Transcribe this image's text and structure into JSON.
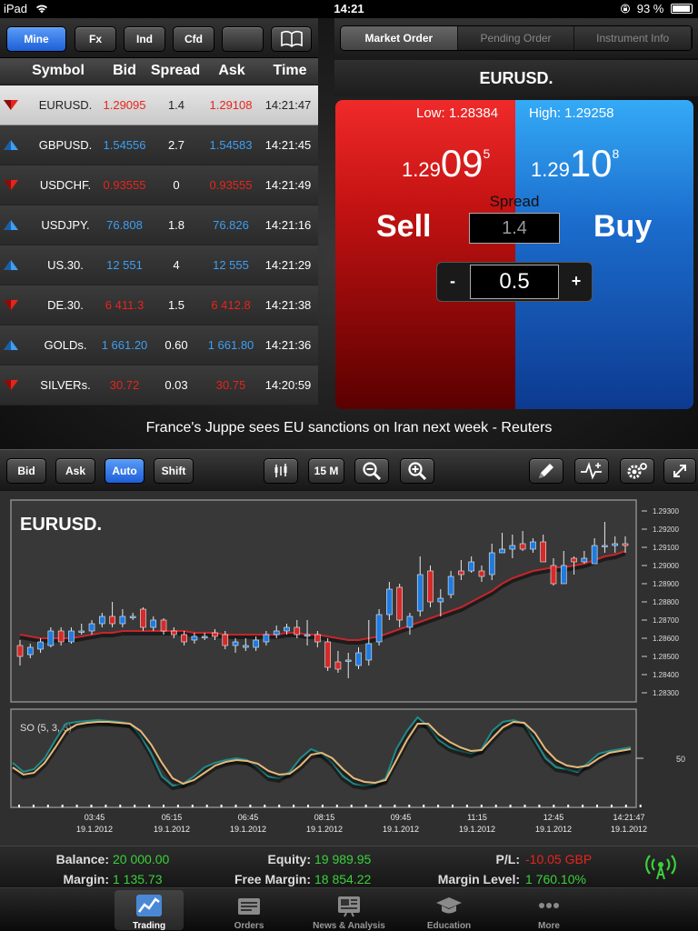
{
  "status": {
    "device": "iPad",
    "time": "14:21",
    "battery": "93 %"
  },
  "left_toolbar": {
    "buttons": [
      "Mine",
      "Fx",
      "Ind",
      "Cfd"
    ],
    "selected": "Mine",
    "book_icon": "book-icon"
  },
  "watchlist": {
    "headers": {
      "symbol": "Symbol",
      "bid": "Bid",
      "spread": "Spread",
      "ask": "Ask",
      "time": "Time"
    },
    "rows": [
      {
        "symbol": "EURUSD.",
        "bid": "1.29095",
        "spread": "1.4",
        "ask": "1.29108",
        "time": "14:21:47",
        "dir": "down",
        "selected": true
      },
      {
        "symbol": "GBPUSD.",
        "bid": "1.54556",
        "spread": "2.7",
        "ask": "1.54583",
        "time": "14:21:45",
        "dir": "up"
      },
      {
        "symbol": "USDCHF.",
        "bid": "0.93555",
        "spread": "0",
        "ask": "0.93555",
        "time": "14:21:49",
        "dir": "down"
      },
      {
        "symbol": "USDJPY.",
        "bid": "76.808",
        "spread": "1.8",
        "ask": "76.826",
        "time": "14:21:16",
        "dir": "up"
      },
      {
        "symbol": "US.30.",
        "bid": "12 551",
        "spread": "4",
        "ask": "12 555",
        "time": "14:21:29",
        "dir": "up"
      },
      {
        "symbol": "DE.30.",
        "bid": "6 411.3",
        "spread": "1.5",
        "ask": "6 412.8",
        "time": "14:21:38",
        "dir": "down"
      },
      {
        "symbol": "GOLDs.",
        "bid": "1 661.20",
        "spread": "0.60",
        "ask": "1 661.80",
        "time": "14:21:36",
        "dir": "up"
      },
      {
        "symbol": "SILVERs.",
        "bid": "30.72",
        "spread": "0.03",
        "ask": "30.75",
        "time": "14:20:59",
        "dir": "down"
      }
    ]
  },
  "order": {
    "tabs": [
      "Market Order",
      "Pending Order",
      "Instrument Info"
    ],
    "selected_tab": "Market Order",
    "instrument": "EURUSD.",
    "low": "Low: 1.28384",
    "high": "High: 1.29258",
    "sell": {
      "base": "1.29",
      "big": "09",
      "small": "5",
      "label": "Sell"
    },
    "buy": {
      "base": "1.29",
      "big": "10",
      "small": "8",
      "label": "Buy"
    },
    "spread_label": "Spread",
    "spread_value": "1.4",
    "volume": "0.5",
    "minus": "-",
    "plus": "+"
  },
  "news": {
    "headline": "France's Juppe sees EU sanctions on Iran next week - Reuters"
  },
  "chart_toolbar": {
    "buttons": [
      "Bid",
      "Ask",
      "Auto",
      "Shift"
    ],
    "selected": "Auto",
    "timeframe": "15 M",
    "icons": [
      "chart-type-icon",
      "zoom-out-icon",
      "zoom-in-icon",
      "pencil-icon",
      "indicator-icon",
      "settings-icon",
      "fullscreen-icon"
    ]
  },
  "chart_data": [
    {
      "type": "candlestick",
      "title": "EURUSD.",
      "y_ticks": [
        "1.29300",
        "1.29200",
        "1.29100",
        "1.29000",
        "1.28900",
        "1.28800",
        "1.28700",
        "1.28600",
        "1.28500",
        "1.28400",
        "1.28300"
      ],
      "ylim": [
        1.2826,
        1.2935
      ],
      "x_ticks": [
        {
          "time": "03:45",
          "date": "19.1.2012"
        },
        {
          "time": "05:15",
          "date": "19.1.2012"
        },
        {
          "time": "06:45",
          "date": "19.1.2012"
        },
        {
          "time": "08:15",
          "date": "19.1.2012"
        },
        {
          "time": "09:45",
          "date": "19.1.2012"
        },
        {
          "time": "11:15",
          "date": "19.1.2012"
        },
        {
          "time": "12:45",
          "date": "19.1.2012"
        },
        {
          "time": "14:21:47",
          "date": "19.1.2012"
        }
      ],
      "candles": [
        [
          1.2856,
          1.285,
          1.2859,
          1.2845
        ],
        [
          1.2851,
          1.2855,
          1.2857,
          1.2849
        ],
        [
          1.2854,
          1.2858,
          1.286,
          1.2852
        ],
        [
          1.2856,
          1.2864,
          1.2866,
          1.2855
        ],
        [
          1.2864,
          1.2858,
          1.2866,
          1.2856
        ],
        [
          1.2858,
          1.2864,
          1.2866,
          1.2857
        ],
        [
          1.2864,
          1.2864,
          1.2868,
          1.2862
        ],
        [
          1.2864,
          1.2868,
          1.287,
          1.2862
        ],
        [
          1.2868,
          1.2872,
          1.2874,
          1.2866
        ],
        [
          1.2872,
          1.2868,
          1.288,
          1.2866
        ],
        [
          1.2868,
          1.2872,
          1.2876,
          1.2866
        ],
        [
          1.2872,
          1.2872,
          1.2874,
          1.287
        ],
        [
          1.2876,
          1.2866,
          1.2877,
          1.2864
        ],
        [
          1.2866,
          1.287,
          1.2872,
          1.2864
        ],
        [
          1.287,
          1.2864,
          1.2871,
          1.2862
        ],
        [
          1.2864,
          1.2862,
          1.2866,
          1.286
        ],
        [
          1.2862,
          1.2858,
          1.2864,
          1.2856
        ],
        [
          1.2859,
          1.2861,
          1.2863,
          1.2857
        ],
        [
          1.2861,
          1.2861,
          1.2863,
          1.2859
        ],
        [
          1.2863,
          1.2861,
          1.2865,
          1.2859
        ],
        [
          1.2862,
          1.2856,
          1.2864,
          1.2854
        ],
        [
          1.2856,
          1.2858,
          1.286,
          1.2852
        ],
        [
          1.2855,
          1.2856,
          1.286,
          1.2853
        ],
        [
          1.2855,
          1.2859,
          1.2861,
          1.2853
        ],
        [
          1.2858,
          1.2862,
          1.2864,
          1.2856
        ],
        [
          1.2862,
          1.2864,
          1.2867,
          1.286
        ],
        [
          1.2864,
          1.2866,
          1.2868,
          1.2862
        ],
        [
          1.2866,
          1.2862,
          1.287,
          1.286
        ],
        [
          1.2862,
          1.2862,
          1.287,
          1.2856
        ],
        [
          1.2862,
          1.2858,
          1.2864,
          1.2855
        ],
        [
          1.2858,
          1.2844,
          1.286,
          1.2842
        ],
        [
          1.2847,
          1.2843,
          1.2853,
          1.2841
        ],
        [
          1.2848,
          1.2848,
          1.2852,
          1.2838
        ],
        [
          1.2845,
          1.2852,
          1.2855,
          1.2843
        ],
        [
          1.2848,
          1.2857,
          1.287,
          1.2845
        ],
        [
          1.2858,
          1.2873,
          1.2876,
          1.2856
        ],
        [
          1.2873,
          1.2887,
          1.2891,
          1.287
        ],
        [
          1.2888,
          1.287,
          1.289,
          1.2866
        ],
        [
          1.2866,
          1.2872,
          1.2874,
          1.2862
        ],
        [
          1.2875,
          1.2895,
          1.2905,
          1.2872
        ],
        [
          1.2897,
          1.288,
          1.29,
          1.2877
        ],
        [
          1.288,
          1.2882,
          1.2887,
          1.2872
        ],
        [
          1.2884,
          1.2894,
          1.2897,
          1.2882
        ],
        [
          1.2897,
          1.2895,
          1.2903,
          1.2892
        ],
        [
          1.2897,
          1.2902,
          1.2905,
          1.2896
        ],
        [
          1.2897,
          1.2894,
          1.29,
          1.2891
        ],
        [
          1.2895,
          1.2907,
          1.2912,
          1.2892
        ],
        [
          1.2907,
          1.2909,
          1.2918,
          1.2907
        ],
        [
          1.2909,
          1.2911,
          1.2917,
          1.2904
        ],
        [
          1.2912,
          1.2909,
          1.2919,
          1.2908
        ],
        [
          1.2909,
          1.2913,
          1.2915,
          1.2907
        ],
        [
          1.2913,
          1.2902,
          1.2917,
          1.2902
        ],
        [
          1.29,
          1.289,
          1.2904,
          1.2889
        ],
        [
          1.289,
          1.29,
          1.2908,
          1.289
        ],
        [
          1.2904,
          1.2902,
          1.2905,
          1.2895
        ],
        [
          1.2902,
          1.2904,
          1.2908,
          1.2901
        ],
        [
          1.2901,
          1.2911,
          1.2915,
          1.2902
        ],
        [
          1.2911,
          1.2911,
          1.2924,
          1.2907
        ],
        [
          1.2911,
          1.2912,
          1.2916,
          1.2907
        ],
        [
          1.2912,
          1.2911,
          1.2916,
          1.2907
        ]
      ],
      "ma": [
        1.2862,
        1.2861,
        1.286,
        1.286,
        1.286,
        1.286,
        1.2861,
        1.2862,
        1.2863,
        1.2863,
        1.2864,
        1.2864,
        1.2864,
        1.2864,
        1.2864,
        1.2864,
        1.2864,
        1.2863,
        1.2863,
        1.2863,
        1.2862,
        1.2862,
        1.2862,
        1.2862,
        1.2862,
        1.2862,
        1.2863,
        1.2863,
        1.2862,
        1.2862,
        1.2861,
        1.286,
        1.2859,
        1.2859,
        1.286,
        1.2861,
        1.2863,
        1.2865,
        1.2867,
        1.2869,
        1.2871,
        1.2873,
        1.2875,
        1.2877,
        1.288,
        1.2883,
        1.2886,
        1.289,
        1.2893,
        1.2895,
        1.2897,
        1.2898,
        1.2899,
        1.2899,
        1.29,
        1.2901,
        1.2903,
        1.2905,
        1.2906,
        1.2908
      ]
    },
    {
      "type": "line",
      "title": "SO (5, 3, 3)",
      "y_ticks": [
        "50"
      ],
      "ylim": [
        0,
        100
      ],
      "series": [
        {
          "color": "#1f8c8a",
          "values": [
            45,
            35,
            38,
            50,
            70,
            88,
            90,
            91,
            92,
            91,
            90,
            88,
            75,
            55,
            30,
            20,
            22,
            30,
            40,
            45,
            48,
            50,
            48,
            40,
            30,
            28,
            35,
            50,
            60,
            55,
            45,
            30,
            22,
            20,
            22,
            28,
            60,
            80,
            95,
            85,
            70,
            62,
            58,
            55,
            60,
            80,
            90,
            92,
            88,
            70,
            50,
            40,
            38,
            35,
            45,
            55,
            58,
            60,
            62
          ]
        },
        {
          "color": "#e8b87a",
          "values": [
            40,
            32,
            34,
            45,
            62,
            80,
            87,
            89,
            90,
            90,
            89,
            88,
            80,
            65,
            45,
            28,
            22,
            26,
            34,
            42,
            46,
            48,
            47,
            44,
            36,
            32,
            33,
            42,
            54,
            56,
            50,
            38,
            28,
            24,
            23,
            26,
            48,
            70,
            88,
            88,
            76,
            68,
            62,
            58,
            59,
            72,
            84,
            90,
            89,
            78,
            60,
            48,
            42,
            40,
            42,
            50,
            56,
            58,
            60
          ]
        }
      ]
    }
  ],
  "account": {
    "balance_label": "Balance:",
    "balance": "20 000.00",
    "equity_label": "Equity:",
    "equity": "19 989.95",
    "pl_label": "P/L:",
    "pl": "-10.05 GBP",
    "margin_label": "Margin:",
    "margin": "1 135.73",
    "free_margin_label": "Free Margin:",
    "free_margin": "18 854.22",
    "margin_level_label": "Margin Level:",
    "margin_level": "1 760.10%"
  },
  "tabbar": {
    "tabs": [
      {
        "label": "Trading",
        "icon": "trading-chart-icon",
        "selected": true
      },
      {
        "label": "Orders",
        "icon": "orders-icon"
      },
      {
        "label": "News & Analysis",
        "icon": "news-icon"
      },
      {
        "label": "Education",
        "icon": "graduation-cap-icon"
      },
      {
        "label": "More",
        "icon": "more-dots-icon"
      }
    ]
  },
  "colors": {
    "up": "#3d9ff2",
    "down": "#e8241c",
    "positive": "#3ad13a",
    "accent": "#1d5fd8"
  }
}
